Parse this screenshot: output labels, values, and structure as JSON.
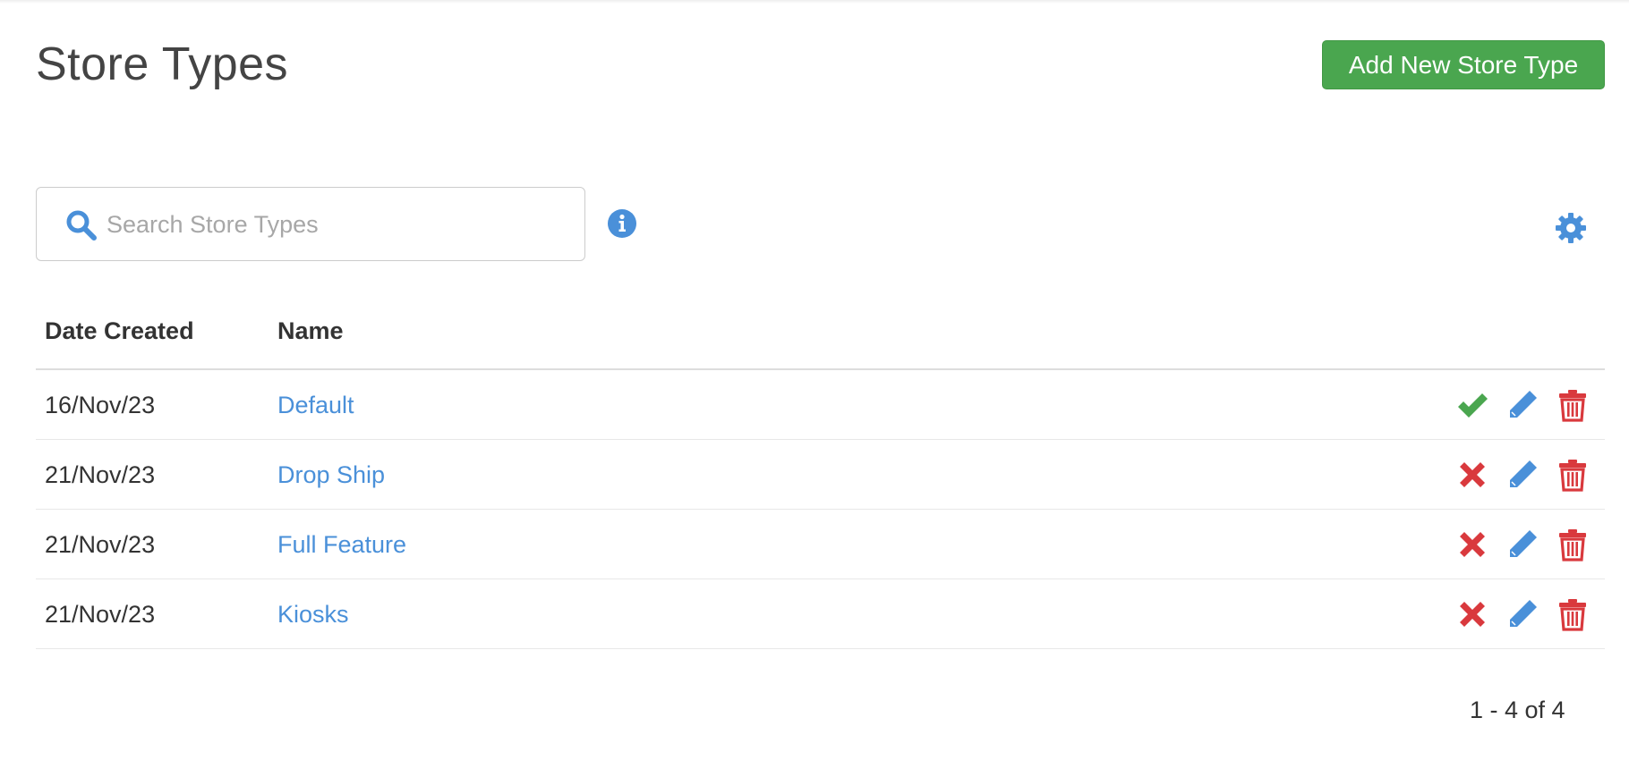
{
  "header": {
    "title": "Store Types",
    "add_button_label": "Add New Store Type"
  },
  "search": {
    "placeholder": "Search Store Types",
    "value": ""
  },
  "icons": {
    "search": "search-icon",
    "info": "info-icon",
    "settings": "gear-icon",
    "active": "check-icon",
    "inactive": "x-icon",
    "edit": "pencil-icon",
    "delete": "trash-icon"
  },
  "colors": {
    "accent_blue": "#4a90d9",
    "success_green": "#4aa64f",
    "danger_red": "#d9393d"
  },
  "table": {
    "columns": [
      "Date Created",
      "Name"
    ],
    "rows": [
      {
        "date_created": "16/Nov/23",
        "name": "Default",
        "active": true
      },
      {
        "date_created": "21/Nov/23",
        "name": "Drop Ship",
        "active": false
      },
      {
        "date_created": "21/Nov/23",
        "name": "Full Feature",
        "active": false
      },
      {
        "date_created": "21/Nov/23",
        "name": "Kiosks",
        "active": false
      }
    ]
  },
  "pagination": {
    "summary": "1 - 4 of 4"
  }
}
